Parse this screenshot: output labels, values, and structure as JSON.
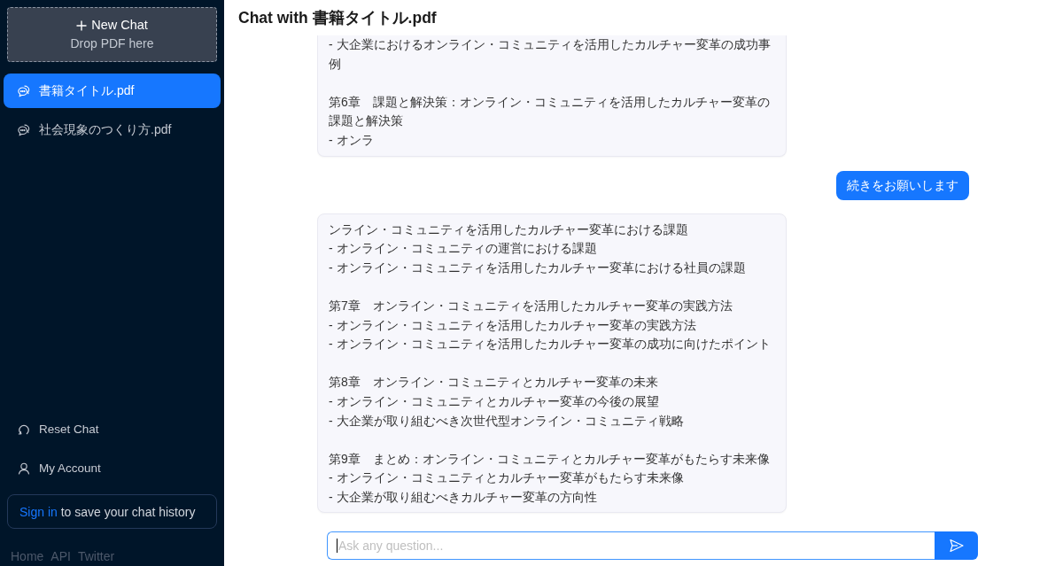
{
  "sidebar": {
    "new_chat": {
      "label": "New Chat",
      "hint": "Drop PDF here"
    },
    "chats": [
      {
        "title": "書籍タイトル.pdf",
        "selected": true
      },
      {
        "title": "社会現象のつくり方.pdf",
        "selected": false
      }
    ],
    "actions": [
      {
        "kind": "reset",
        "label": "Reset Chat"
      },
      {
        "kind": "account",
        "label": "My Account"
      }
    ],
    "sign_in": {
      "link": "Sign in",
      "text": "to save your chat history"
    },
    "footer_links": [
      "Home",
      "API",
      "Twitter"
    ]
  },
  "chat": {
    "title": "Chat with 書籍タイトル.pdf",
    "messages": [
      {
        "kind": "answer",
        "blocks": [
          [
            "- 大企業におけるオンライン・コミュニティを活用したカルチャー変革の成功事例"
          ],
          [
            "第6章　課題と解決策：オンライン・コミュニティを活用したカルチャー変革の課題と解決策",
            "- オンラ"
          ]
        ]
      },
      {
        "kind": "question",
        "text": "続きをお願いします"
      },
      {
        "kind": "answer",
        "blocks": [
          [
            "ンライン・コミュニティを活用したカルチャー変革における課題",
            "- オンライン・コミュニティの運営における課題",
            "- オンライン・コミュニティを活用したカルチャー変革における社員の課題"
          ],
          [
            "第7章　オンライン・コミュニティを活用したカルチャー変革の実践方法",
            "- オンライン・コミュニティを活用したカルチャー変革の実践方法",
            "- オンライン・コミュニティを活用したカルチャー変革の成功に向けたポイント"
          ],
          [
            "第8章　オンライン・コミュニティとカルチャー変革の未来",
            "- オンライン・コミュニティとカルチャー変革の今後の展望",
            "- 大企業が取り組むべき次世代型オンライン・コミュニティ戦略"
          ],
          [
            "第9章　まとめ：オンライン・コミュニティとカルチャー変革がもたらす未来像",
            "- オンライン・コミュニティとカルチャー変革がもたらす未来像",
            "- 大企業が取り組むべきカルチャー変革の方向性"
          ]
        ]
      }
    ]
  },
  "composer": {
    "placeholder": "Ask any question...",
    "focused": true
  }
}
